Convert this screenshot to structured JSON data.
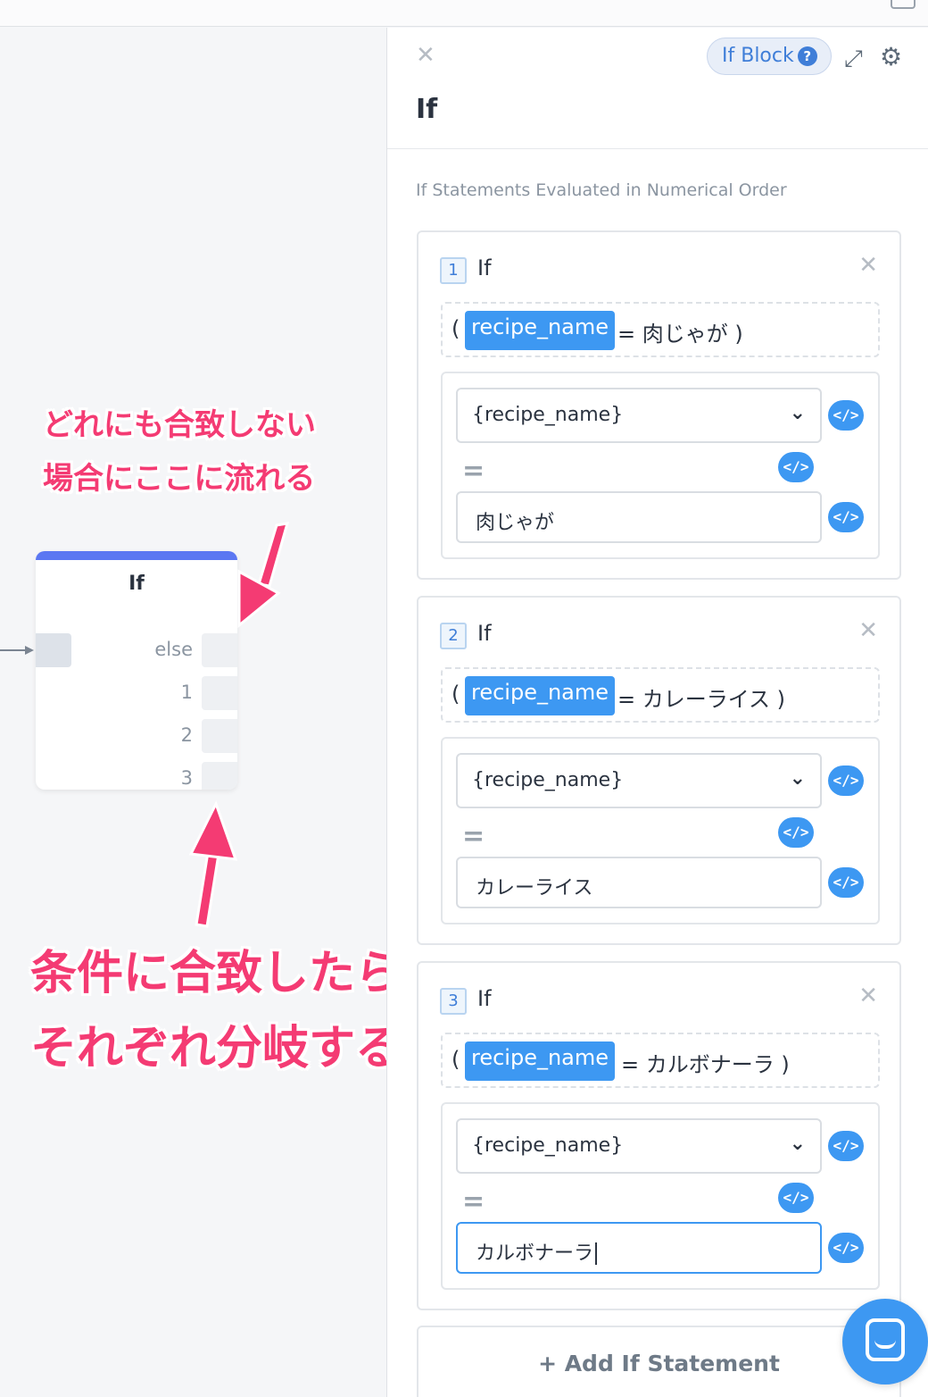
{
  "canvas": {
    "node": {
      "title": "If",
      "rows": [
        {
          "label": "else"
        },
        {
          "label": "1"
        },
        {
          "label": "2"
        },
        {
          "label": "3"
        }
      ]
    },
    "annotations": {
      "small_line1": "どれにも合致しない",
      "small_line2": "場合にここに流れる",
      "big_line1": "条件に合致したら",
      "big_line2": "それぞれ分岐する"
    }
  },
  "panel": {
    "block_type": "If Block",
    "help_glyph": "?",
    "title": "If",
    "order_note": "If Statements Evaluated in Numerical Order",
    "statements": [
      {
        "number": "1",
        "label": "If",
        "open_paren": "(",
        "variable": "recipe_name",
        "condition_text": "= 肉じゃが )",
        "select_value": "{recipe_name}",
        "equals_sign": "=",
        "value": "肉じゃが"
      },
      {
        "number": "2",
        "label": "If",
        "open_paren": "(",
        "variable": "recipe_name",
        "condition_text": "= カレーライス )",
        "select_value": "{recipe_name}",
        "equals_sign": "=",
        "value": "カレーライス"
      },
      {
        "number": "3",
        "label": "If",
        "open_paren": "(",
        "variable": "recipe_name",
        "condition_text": "= カルボナーラ )",
        "select_value": "{recipe_name}",
        "equals_sign": "=",
        "value": "カルボナーラ"
      }
    ],
    "add_button": "+ Add If Statement"
  },
  "colors": {
    "accent": "#3d98f2",
    "node_header": "#5b77f2",
    "annotation": "#f43b73"
  },
  "icons": {
    "close": "close-icon",
    "expand": "expand-icon",
    "settings": "gear-icon",
    "code": "code-icon",
    "chat": "chat-icon"
  }
}
